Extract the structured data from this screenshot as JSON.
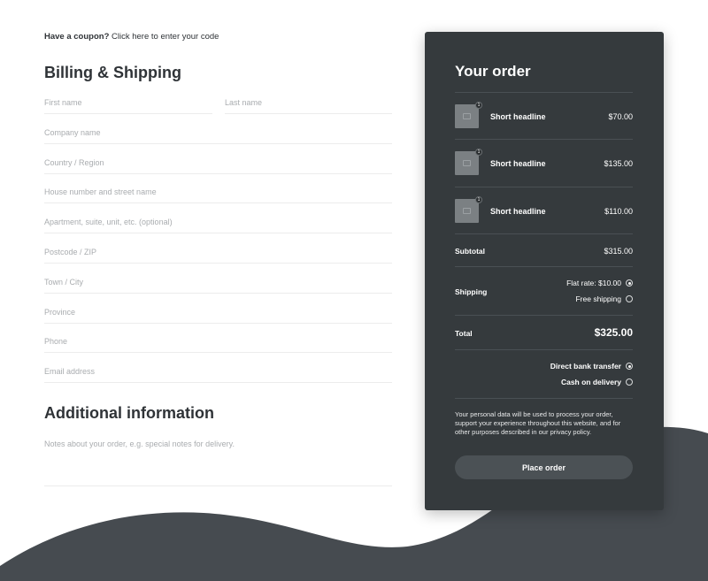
{
  "coupon": {
    "prefix": "Have a coupon?",
    "link": "Click here to enter your code"
  },
  "billing": {
    "title": "Billing & Shipping",
    "fields": {
      "first_name": "First name",
      "last_name": "Last name",
      "company": "Company name",
      "country": "Country / Region",
      "street": "House number and street name",
      "apartment": "Apartment, suite, unit, etc. (optional)",
      "postcode": "Postcode / ZIP",
      "town": "Town / City",
      "province": "Province",
      "phone": "Phone",
      "email": "Email address"
    }
  },
  "additional": {
    "title": "Additional information",
    "notes_placeholder": "Notes about your order, e.g. special notes for delivery."
  },
  "order": {
    "title": "Your order",
    "items": [
      {
        "name": "Short headline",
        "price": "$70.00",
        "qty": "1"
      },
      {
        "name": "Short headline",
        "price": "$135.00",
        "qty": "1"
      },
      {
        "name": "Short headline",
        "price": "$110.00",
        "qty": "1"
      }
    ],
    "subtotal_label": "Subtotal",
    "subtotal_value": "$315.00",
    "shipping_label": "Shipping",
    "shipping_options": [
      {
        "label": "Flat rate: $10.00",
        "selected": true
      },
      {
        "label": "Free shipping",
        "selected": false
      }
    ],
    "total_label": "Total",
    "total_value": "$325.00",
    "payment_options": [
      {
        "label": "Direct bank transfer",
        "selected": true
      },
      {
        "label": "Cash on delivery",
        "selected": false
      }
    ],
    "privacy_text": "Your personal data will be used to process your order, support your experience throughout this website, and for other purposes described in our privacy policy.",
    "place_order_label": "Place order"
  },
  "colors": {
    "panel_bg": "#353a3d",
    "wave": "#464b50",
    "button_bg": "#4b5155",
    "text_dark": "#2f3337"
  },
  "icons": [
    "image-placeholder-icon",
    "radio-checked-icon",
    "radio-unchecked-icon"
  ]
}
